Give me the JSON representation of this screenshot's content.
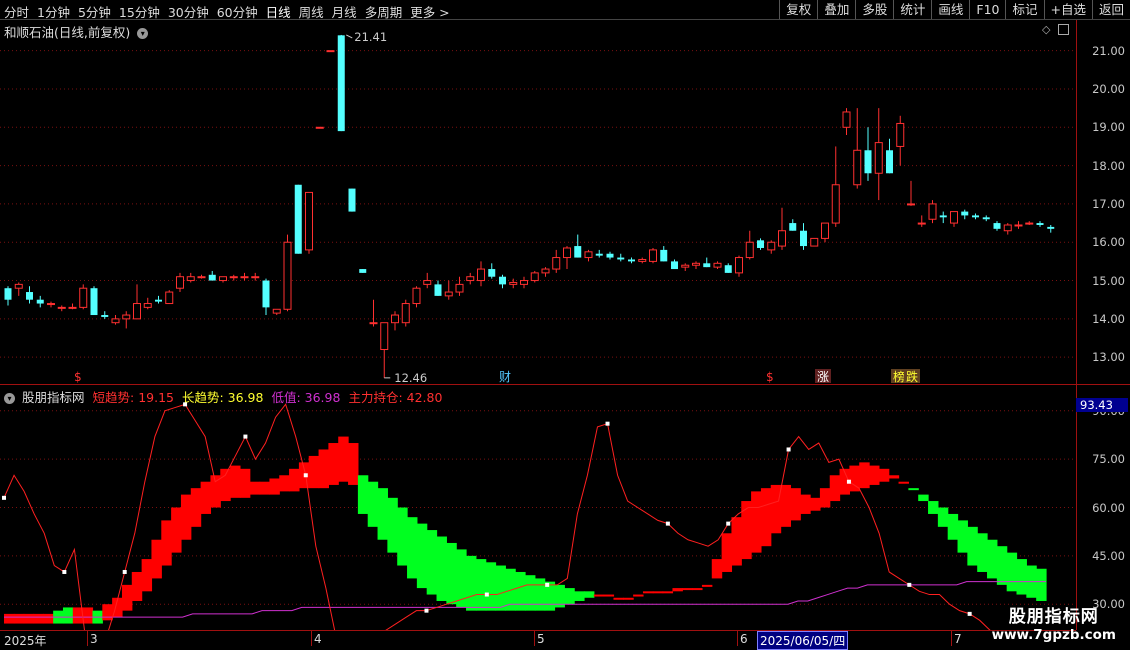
{
  "toolbar": {
    "periods": [
      "分时",
      "1分钟",
      "5分钟",
      "15分钟",
      "30分钟",
      "60分钟",
      "日线",
      "周线",
      "月线",
      "多周期",
      "更多 >"
    ],
    "active_period": "日线",
    "actions": [
      "复权",
      "叠加",
      "多股",
      "统计",
      "画线",
      "F10",
      "标记",
      "+自选",
      "返回"
    ]
  },
  "main_chart": {
    "stock_name": "和顺石油(日线,前复权)",
    "y_ticks": [
      "21.00",
      "20.00",
      "19.00",
      "18.00",
      "17.00",
      "16.00",
      "15.00",
      "14.00",
      "13.00"
    ],
    "high_label": "21.41",
    "low_label": "12.46",
    "event_marks": [
      "$",
      "财",
      "$",
      "涨",
      "榜",
      "跌"
    ],
    "up_color": "#ff3030",
    "down_color": "#54ffff"
  },
  "chart_data": [
    {
      "type": "candlestick",
      "title": "和顺石油(日线,前复权)",
      "ylim": [
        12.3,
        21.8
      ],
      "annotations": [
        "21.41",
        "12.46"
      ],
      "candles_ohlc": [
        [
          14.8,
          14.85,
          14.35,
          14.5
        ],
        [
          14.8,
          14.95,
          14.6,
          14.9
        ],
        [
          14.7,
          14.85,
          14.4,
          14.5
        ],
        [
          14.5,
          14.6,
          14.3,
          14.4
        ],
        [
          14.4,
          14.45,
          14.3,
          14.4
        ],
        [
          14.3,
          14.35,
          14.2,
          14.3
        ],
        [
          14.3,
          14.4,
          14.25,
          14.3
        ],
        [
          14.3,
          14.9,
          14.25,
          14.8
        ],
        [
          14.8,
          14.85,
          14.2,
          14.1
        ],
        [
          14.1,
          14.2,
          14.0,
          14.05
        ],
        [
          13.9,
          14.1,
          13.85,
          14.0
        ],
        [
          14.0,
          14.2,
          13.75,
          14.1
        ],
        [
          14.0,
          14.9,
          14.0,
          14.4
        ],
        [
          14.3,
          14.55,
          14.25,
          14.4
        ],
        [
          14.5,
          14.6,
          14.4,
          14.45
        ],
        [
          14.4,
          14.75,
          14.4,
          14.7
        ],
        [
          14.8,
          15.2,
          14.7,
          15.1
        ],
        [
          15.0,
          15.2,
          14.95,
          15.1
        ],
        [
          15.1,
          15.15,
          15.05,
          15.1
        ],
        [
          15.15,
          15.25,
          15.0,
          15.0
        ],
        [
          15.0,
          15.1,
          14.95,
          15.1
        ],
        [
          15.1,
          15.15,
          15.0,
          15.1
        ],
        [
          15.1,
          15.2,
          15.0,
          15.1
        ],
        [
          15.1,
          15.2,
          15.0,
          15.1
        ],
        [
          15.0,
          15.05,
          14.1,
          14.3
        ],
        [
          14.15,
          14.25,
          14.1,
          14.25
        ],
        [
          14.25,
          16.2,
          14.2,
          16.0
        ],
        [
          17.5,
          17.5,
          15.7,
          15.7
        ],
        [
          15.8,
          17.3,
          15.7,
          17.3
        ],
        [
          19.0,
          19.0,
          19.0,
          19.0
        ],
        [
          21.0,
          21.0,
          21.0,
          21.0
        ],
        [
          21.4,
          21.41,
          18.9,
          18.9
        ],
        [
          17.4,
          17.4,
          16.8,
          16.8
        ],
        [
          15.3,
          15.3,
          15.2,
          15.2
        ],
        [
          13.9,
          14.5,
          13.8,
          13.9
        ],
        [
          13.2,
          13.9,
          12.46,
          13.9
        ],
        [
          13.9,
          14.2,
          13.7,
          14.1
        ],
        [
          13.9,
          14.5,
          13.8,
          14.4
        ],
        [
          14.4,
          14.85,
          14.3,
          14.8
        ],
        [
          14.9,
          15.2,
          14.8,
          15.0
        ],
        [
          14.9,
          15.0,
          14.6,
          14.6
        ],
        [
          14.6,
          15.0,
          14.5,
          14.7
        ],
        [
          14.7,
          15.1,
          14.6,
          14.9
        ],
        [
          15.0,
          15.2,
          14.9,
          15.1
        ],
        [
          15.0,
          15.5,
          14.85,
          15.3
        ],
        [
          15.3,
          15.45,
          15.05,
          15.1
        ],
        [
          15.1,
          15.15,
          14.8,
          14.9
        ],
        [
          14.9,
          15.05,
          14.8,
          14.95
        ],
        [
          14.9,
          15.1,
          14.8,
          15.0
        ],
        [
          15.0,
          15.25,
          14.95,
          15.2
        ],
        [
          15.2,
          15.35,
          15.1,
          15.3
        ],
        [
          15.3,
          15.8,
          15.2,
          15.6
        ],
        [
          15.6,
          15.9,
          15.3,
          15.85
        ],
        [
          15.9,
          16.2,
          15.6,
          15.6
        ],
        [
          15.6,
          15.8,
          15.5,
          15.75
        ],
        [
          15.7,
          15.8,
          15.6,
          15.65
        ],
        [
          15.7,
          15.75,
          15.55,
          15.6
        ],
        [
          15.6,
          15.7,
          15.5,
          15.55
        ],
        [
          15.55,
          15.6,
          15.45,
          15.5
        ],
        [
          15.5,
          15.6,
          15.45,
          15.55
        ],
        [
          15.5,
          15.85,
          15.45,
          15.8
        ],
        [
          15.8,
          15.9,
          15.5,
          15.5
        ],
        [
          15.5,
          15.55,
          15.3,
          15.3
        ],
        [
          15.35,
          15.45,
          15.25,
          15.4
        ],
        [
          15.4,
          15.5,
          15.3,
          15.45
        ],
        [
          15.45,
          15.6,
          15.35,
          15.35
        ],
        [
          15.35,
          15.5,
          15.3,
          15.45
        ],
        [
          15.4,
          15.45,
          15.2,
          15.2
        ],
        [
          15.2,
          15.65,
          15.1,
          15.6
        ],
        [
          15.6,
          16.3,
          15.55,
          16.0
        ],
        [
          16.05,
          16.1,
          15.8,
          15.85
        ],
        [
          15.8,
          16.05,
          15.7,
          16.0
        ],
        [
          15.9,
          16.9,
          15.8,
          16.3
        ],
        [
          16.5,
          16.6,
          16.3,
          16.3
        ],
        [
          16.3,
          16.5,
          15.8,
          15.9
        ],
        [
          15.9,
          16.1,
          15.9,
          16.1
        ],
        [
          16.1,
          16.5,
          16.0,
          16.5
        ],
        [
          16.5,
          18.5,
          16.4,
          17.5
        ],
        [
          19.0,
          19.5,
          18.8,
          19.4
        ],
        [
          17.5,
          19.5,
          17.4,
          18.4
        ],
        [
          18.4,
          19.0,
          17.6,
          17.8
        ],
        [
          17.8,
          19.5,
          17.1,
          18.6
        ],
        [
          18.4,
          18.7,
          17.8,
          17.8
        ],
        [
          18.5,
          19.3,
          18.0,
          19.1
        ],
        [
          17.0,
          17.6,
          16.95,
          17.0
        ],
        [
          16.5,
          16.7,
          16.4,
          16.5
        ],
        [
          16.6,
          17.1,
          16.5,
          17.0
        ],
        [
          16.7,
          16.8,
          16.5,
          16.65
        ],
        [
          16.5,
          16.8,
          16.4,
          16.8
        ],
        [
          16.8,
          16.85,
          16.6,
          16.7
        ],
        [
          16.7,
          16.75,
          16.6,
          16.65
        ],
        [
          16.65,
          16.7,
          16.55,
          16.6
        ],
        [
          16.5,
          16.55,
          16.3,
          16.35
        ],
        [
          16.3,
          16.5,
          16.2,
          16.45
        ],
        [
          16.45,
          16.55,
          16.35,
          16.45
        ],
        [
          16.5,
          16.55,
          16.45,
          16.5
        ],
        [
          16.5,
          16.55,
          16.4,
          16.45
        ],
        [
          16.4,
          16.45,
          16.25,
          16.35
        ]
      ]
    },
    {
      "type": "area",
      "title": "股朋指标网",
      "ylim": [
        22,
        98
      ],
      "series": [
        {
          "name": "短趋势",
          "current": 19.15,
          "color": "#ff3030"
        },
        {
          "name": "长趋势",
          "current": 36.98,
          "color": "#ffff30"
        },
        {
          "name": "低值",
          "current": 36.98,
          "color": "#d030d0"
        },
        {
          "name": "主力持仓",
          "current": 42.8,
          "color": "#ff3030"
        }
      ],
      "y_ticks": [
        "90.00",
        "75.00",
        "60.00",
        "45.00",
        "30.00"
      ],
      "readout": "93.43",
      "short_trend": [
        63,
        70,
        65,
        58,
        52,
        42,
        40,
        47,
        22,
        14,
        18,
        28,
        40,
        52,
        68,
        82,
        90,
        91,
        92,
        87,
        82,
        68,
        70,
        76,
        82,
        75,
        80,
        88,
        92,
        82,
        70,
        48,
        35,
        20,
        16,
        17,
        19,
        20,
        22,
        24,
        26,
        28,
        28,
        29,
        30,
        31,
        32,
        33,
        33,
        33,
        34,
        35,
        36,
        36,
        36,
        36,
        38,
        58,
        70,
        85,
        86,
        70,
        62,
        60,
        58,
        56,
        55,
        52,
        50,
        49,
        48,
        50,
        55,
        58,
        60,
        60,
        61,
        62,
        78,
        82,
        78,
        80,
        74,
        75,
        68,
        66,
        60,
        52,
        40,
        38,
        36,
        34,
        33,
        33,
        30,
        28,
        27,
        25,
        22,
        20,
        18,
        16,
        13
      ],
      "long_band_top": [
        27,
        27,
        27,
        27,
        27,
        28,
        29,
        29,
        29,
        28,
        30,
        32,
        36,
        40,
        44,
        50,
        56,
        60,
        64,
        66,
        68,
        70,
        72,
        73,
        72,
        68,
        68,
        69,
        70,
        72,
        74,
        76,
        78,
        80,
        82,
        80,
        70,
        68,
        66,
        63,
        60,
        57,
        55,
        53,
        51,
        49,
        47,
        45,
        44,
        43,
        42,
        41,
        40,
        39,
        38,
        37,
        36,
        35,
        34,
        34,
        33,
        33,
        32,
        32,
        33,
        34,
        34,
        34,
        35,
        35,
        35,
        36,
        44,
        52,
        57,
        62,
        65,
        66,
        67,
        67,
        66,
        64,
        63,
        66,
        70,
        72,
        73,
        74,
        73,
        72,
        70,
        68,
        66,
        64,
        62,
        60,
        58,
        56,
        54,
        52,
        50,
        48,
        46,
        44,
        42,
        41
      ],
      "long_band_bottom": [
        24,
        24,
        24,
        24,
        24,
        24,
        24,
        24,
        24,
        24,
        25,
        26,
        28,
        31,
        34,
        38,
        42,
        46,
        50,
        54,
        58,
        60,
        62,
        63,
        63,
        64,
        64,
        64,
        65,
        65,
        66,
        66,
        66,
        67,
        68,
        67,
        58,
        54,
        50,
        46,
        42,
        38,
        35,
        33,
        31,
        30,
        29,
        28,
        28,
        28,
        28,
        28,
        28,
        28,
        28,
        28,
        29,
        30,
        31,
        32,
        33,
        33,
        33,
        33,
        34,
        34,
        34,
        34,
        34,
        35,
        35,
        36,
        38,
        40,
        42,
        44,
        46,
        48,
        52,
        54,
        56,
        58,
        59,
        60,
        62,
        64,
        65,
        66,
        67,
        68,
        69,
        68,
        66,
        62,
        58,
        54,
        50,
        46,
        42,
        40,
        38,
        36,
        34,
        33,
        32,
        31
      ],
      "long_band_colors": [
        "r",
        "r",
        "r",
        "r",
        "r",
        "g",
        "g",
        "r",
        "r",
        "g",
        "r",
        "r",
        "r",
        "r",
        "r",
        "r",
        "r",
        "r",
        "r",
        "r",
        "r",
        "r",
        "r",
        "r",
        "r",
        "r",
        "r",
        "r",
        "r",
        "r",
        "r",
        "r",
        "r",
        "r",
        "r",
        "r",
        "g",
        "g",
        "g",
        "g",
        "g",
        "g",
        "g",
        "g",
        "g",
        "g",
        "g",
        "g",
        "g",
        "g",
        "g",
        "g",
        "g",
        "g",
        "g",
        "g",
        "g",
        "g",
        "g",
        "g",
        "r",
        "r",
        "r",
        "r",
        "r",
        "r",
        "r",
        "r",
        "r",
        "r",
        "r",
        "r",
        "r",
        "r",
        "r",
        "r",
        "r",
        "r",
        "r",
        "r",
        "r",
        "r",
        "r",
        "r",
        "r",
        "r",
        "r",
        "r",
        "r",
        "r",
        "r",
        "r",
        "g",
        "g",
        "g",
        "g",
        "g",
        "g",
        "g",
        "g",
        "g",
        "g",
        "g",
        "g",
        "g",
        "g"
      ],
      "low_value": [
        26,
        26,
        26,
        26,
        26,
        26,
        26,
        26,
        26,
        26,
        26,
        26,
        26,
        26,
        26,
        26,
        26,
        26,
        26,
        27,
        27,
        27,
        27,
        27,
        27,
        27,
        28,
        28,
        28,
        28,
        29,
        29,
        29,
        29,
        29,
        29,
        29,
        29,
        29,
        29,
        29,
        29,
        29,
        29,
        29,
        29,
        29,
        29,
        29,
        29,
        29,
        30,
        30,
        30,
        30,
        30,
        30,
        30,
        30,
        30,
        30,
        30,
        30,
        30,
        30,
        30,
        30,
        30,
        30,
        30,
        30,
        30,
        30,
        30,
        30,
        30,
        30,
        30,
        30,
        30,
        31,
        31,
        32,
        33,
        34,
        35,
        35,
        36,
        36,
        36,
        36,
        36,
        36,
        36,
        36,
        36,
        36,
        37,
        37,
        37,
        37,
        37,
        37,
        37,
        37,
        37
      ]
    }
  ],
  "indicator_panel": {
    "title": "股朋指标网",
    "legend": [
      {
        "label": "短趋势:",
        "value": "19.15"
      },
      {
        "label": "长趋势:",
        "value": "36.98"
      },
      {
        "label": "低值:",
        "value": "36.98"
      },
      {
        "label": "主力持仓:",
        "value": "42.80"
      }
    ],
    "y_ticks": [
      "90.00",
      "75.00",
      "60.00",
      "45.00",
      "30.00"
    ],
    "readout": "93.43"
  },
  "date_axis": {
    "labels": [
      "2025年",
      "3",
      "4",
      "5",
      "6",
      "7"
    ],
    "highlight": "2025/06/05/四"
  },
  "watermark": {
    "line1": "股朋指标网",
    "line2": "www.7gpzb.com"
  }
}
